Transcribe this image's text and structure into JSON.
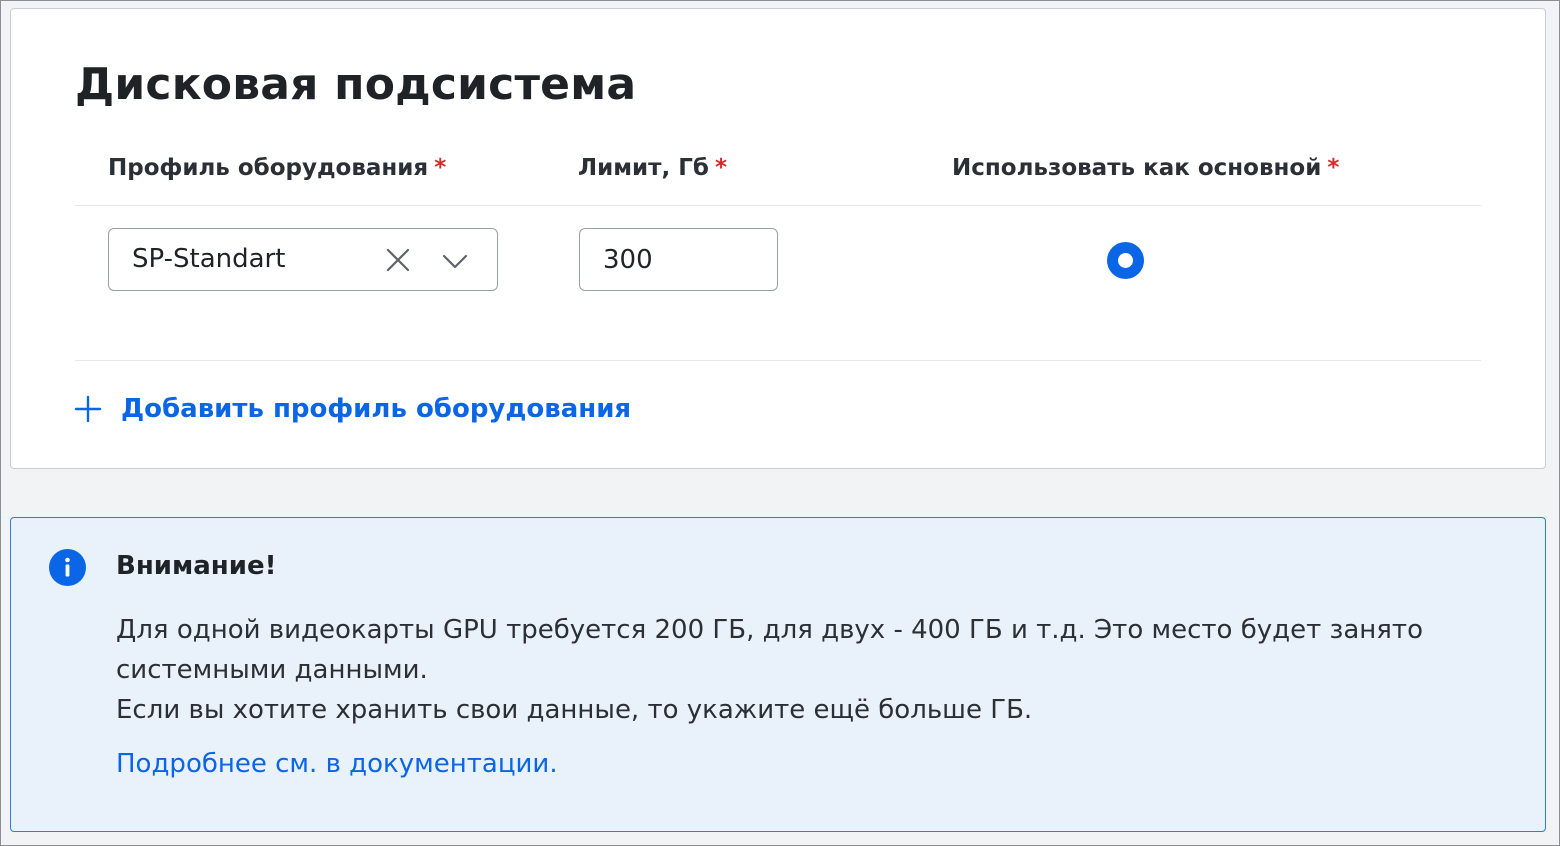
{
  "disk_section": {
    "title": "Дисковая подсистема",
    "columns": {
      "profile": "Профиль оборудования",
      "limit": "Лимит, Гб",
      "primary": "Использовать как основной"
    },
    "required_mark": "*",
    "row": {
      "profile_value": "SP-Standart",
      "limit_value": "300",
      "primary_selected": true
    },
    "add_profile_label": "Добавить профиль оборудования"
  },
  "alert": {
    "title": "Внимание!",
    "lines": [
      "Для одной видеокарты GPU требуется 200 ГБ, для двух - 400 ГБ и т.д. Это место будет занято",
      "системными данными.",
      "Если вы хотите хранить свои данные, то укажите ещё больше ГБ."
    ],
    "link_text": "Подробнее см. в документации."
  },
  "colors": {
    "accent": "#0a66e6",
    "required": "#d62b2b",
    "alert_background": "#e9f1fb",
    "alert_border": "#2f7ae5"
  },
  "icons": {
    "clear": "close-icon",
    "dropdown": "chevron-down-icon",
    "add": "plus-icon",
    "info": "info-icon"
  }
}
